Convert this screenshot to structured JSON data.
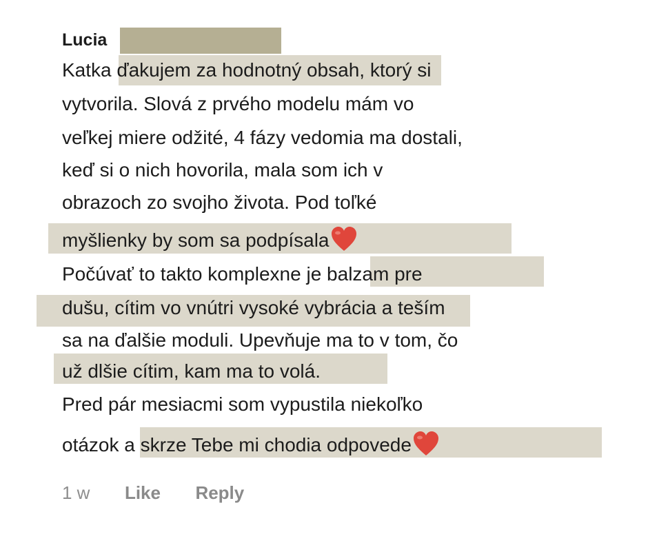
{
  "comment": {
    "author": "Lucia",
    "lines": [
      "Katka ďakujem za hodnotný obsah, ktorý si",
      "vytvorila. Slová z prvého modelu mám vo",
      "veľkej miere odžité, 4 fázy vedomia ma dostali,",
      "keď si o nich hovorila, mala som ich v",
      "obrazoch zo svojho života. Pod toľké",
      "myšlienky by som sa podpísala",
      "Počúvať to takto komplexne je balzam pre",
      "dušu, cítim vo vnútri vysoké vybrácia a teším",
      "sa na ďalšie moduli. Upevňuje ma to v tom, čo",
      "už dlšie cítim, kam ma to volá.",
      "Pred pár mesiacmi som vypustila niekoľko",
      "otázok a skrze Tebe mi chodia odpovede"
    ],
    "icons": {
      "heart": "red-heart-emoji",
      "heart_color": "#e0463b"
    }
  },
  "actions": {
    "time": "1 w",
    "like_label": "Like",
    "reply_label": "Reply"
  },
  "colors": {
    "highlight": "#dcd8cb",
    "redaction": "#b5af93",
    "text": "#1c1c1c",
    "muted": "#8a8a8a"
  }
}
